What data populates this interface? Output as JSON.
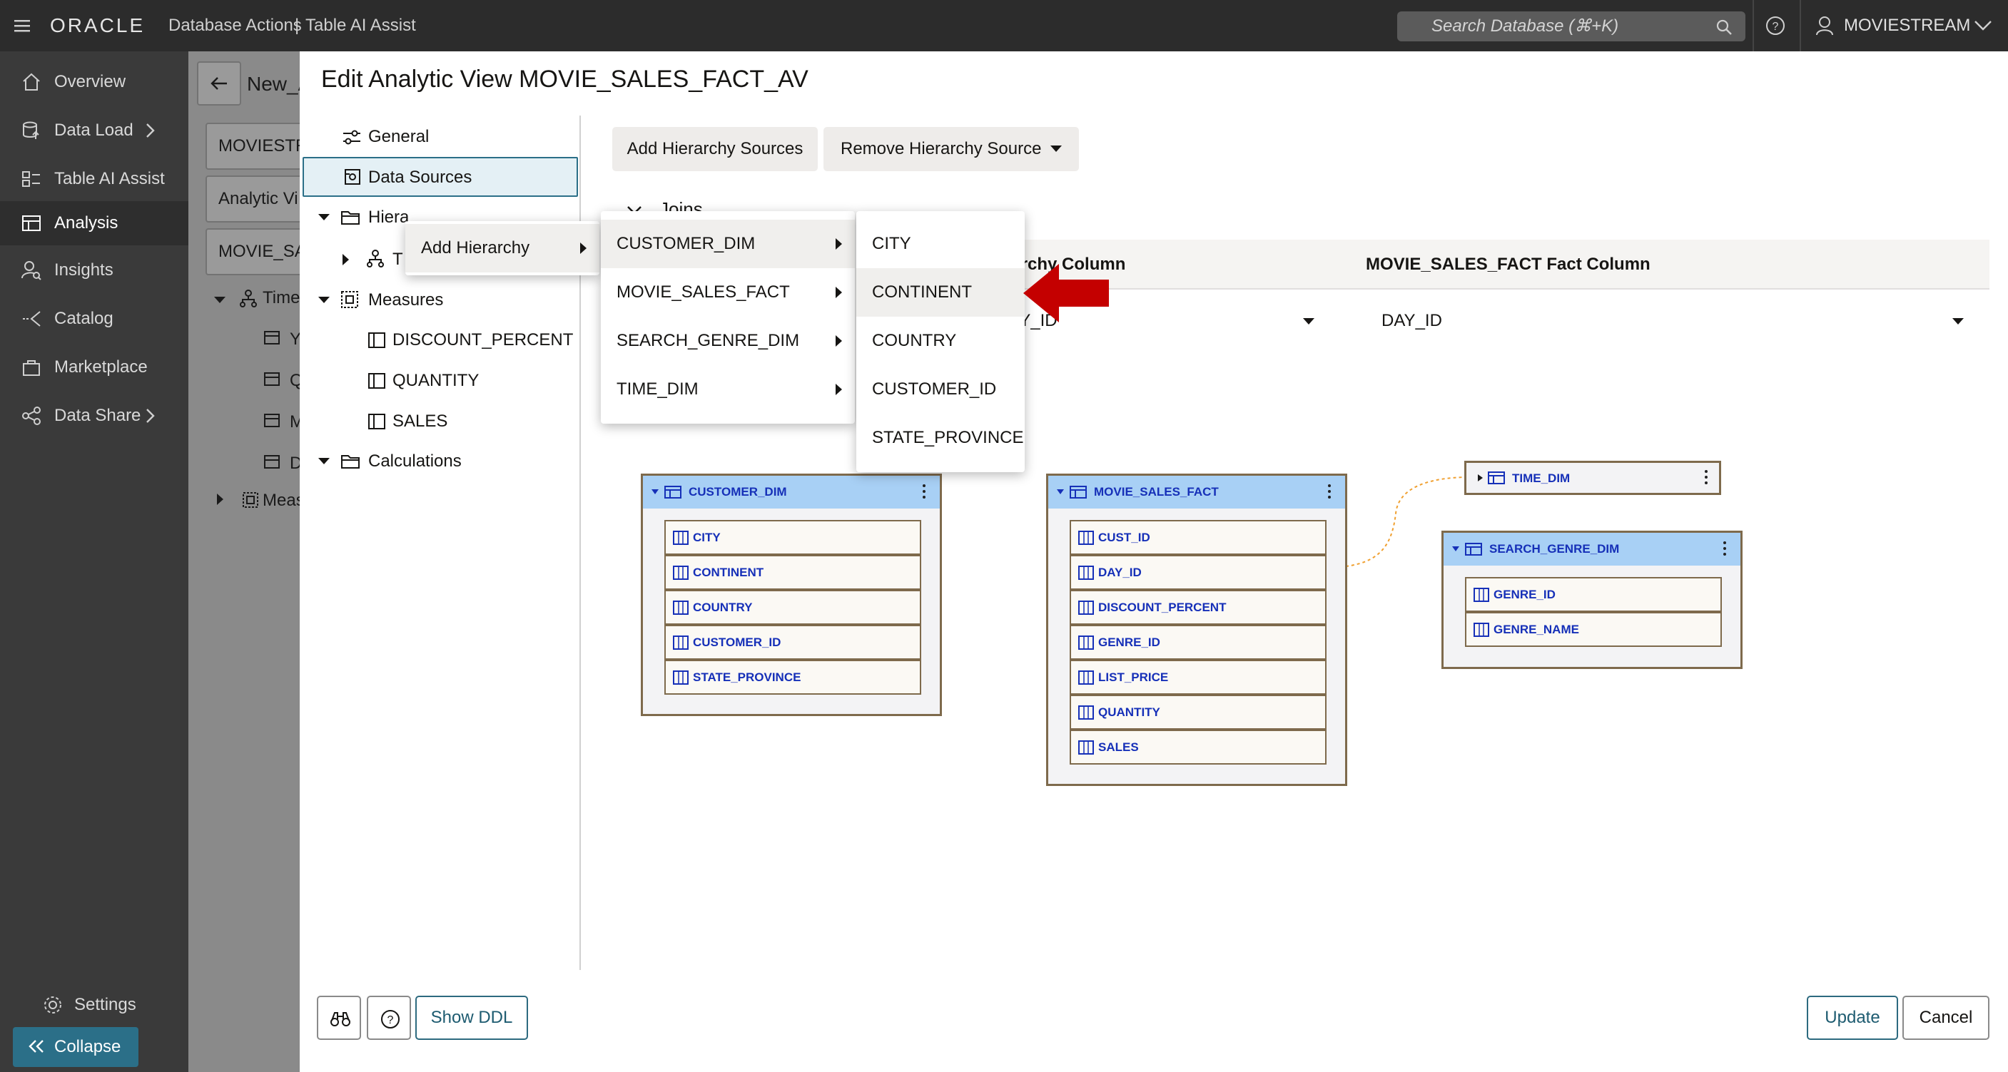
{
  "topbar": {
    "brand": "ORACLE",
    "app": "Database Actions",
    "separator": "|",
    "section": "Table AI Assist",
    "search_placeholder": "Search Database (⌘+K)",
    "user": "MOVIESTREAM"
  },
  "nav": {
    "items": [
      {
        "label": "Overview"
      },
      {
        "label": "Data Load"
      },
      {
        "label": "Table AI Assist"
      },
      {
        "label": "Analysis"
      },
      {
        "label": "Insights"
      },
      {
        "label": "Catalog"
      },
      {
        "label": "Marketplace"
      },
      {
        "label": "Data Share"
      }
    ],
    "settings": "Settings",
    "collapse": "Collapse"
  },
  "background_page": {
    "title": "New_A",
    "field1": "MOVIESTR",
    "field2": "Analytic Vi",
    "field3": "MOVIE_SA",
    "tree": [
      "Time",
      "Y",
      "Q",
      "M",
      "D",
      "Meas"
    ]
  },
  "dialog": {
    "title": "Edit Analytic View MOVIE_SALES_FACT_AV",
    "tree": {
      "general": "General",
      "data_sources": "Data Sources",
      "hierarchies": "Hiera",
      "hier_child": "T",
      "measures": "Measures",
      "measure_items": [
        "DISCOUNT_PERCENT",
        "QUANTITY",
        "SALES"
      ],
      "calculations": "Calculations"
    },
    "toolbar": {
      "add_sources": "Add Hierarchy Sources",
      "remove_source": "Remove Hierarchy Source"
    },
    "joins_label": "Joins",
    "table": {
      "col1_header": "rarchy Column",
      "col2_header": "MOVIE_SALES_FACT Fact Column",
      "row1_col1": "AY_ID",
      "row1_col2": "DAY_ID"
    },
    "footer": {
      "show_ddl": "Show DDL",
      "update": "Update",
      "cancel": "Cancel"
    }
  },
  "context_menu": {
    "level1": [
      "Add Hierarchy"
    ],
    "level2": [
      "CUSTOMER_DIM",
      "MOVIE_SALES_FACT",
      "SEARCH_GENRE_DIM",
      "TIME_DIM"
    ],
    "level3": [
      "CITY",
      "CONTINENT",
      "COUNTRY",
      "CUSTOMER_ID",
      "STATE_PROVINCE"
    ],
    "highlighted": "CONTINENT"
  },
  "diagram": {
    "customer_dim": {
      "name": "CUSTOMER_DIM",
      "columns": [
        "CITY",
        "CONTINENT",
        "COUNTRY",
        "CUSTOMER_ID",
        "STATE_PROVINCE"
      ]
    },
    "movie_sales_fact": {
      "name": "MOVIE_SALES_FACT",
      "columns": [
        "CUST_ID",
        "DAY_ID",
        "DISCOUNT_PERCENT",
        "GENRE_ID",
        "LIST_PRICE",
        "QUANTITY",
        "SALES"
      ]
    },
    "time_dim": {
      "name": "TIME_DIM"
    },
    "search_genre_dim": {
      "name": "SEARCH_GENRE_DIM",
      "columns": [
        "GENRE_ID",
        "GENRE_NAME"
      ]
    }
  },
  "colors": {
    "accent_arrow": "#c40000",
    "entity_header": "#a8d0f5",
    "entity_text": "#1630b8",
    "entity_border": "#7e6a4c"
  }
}
